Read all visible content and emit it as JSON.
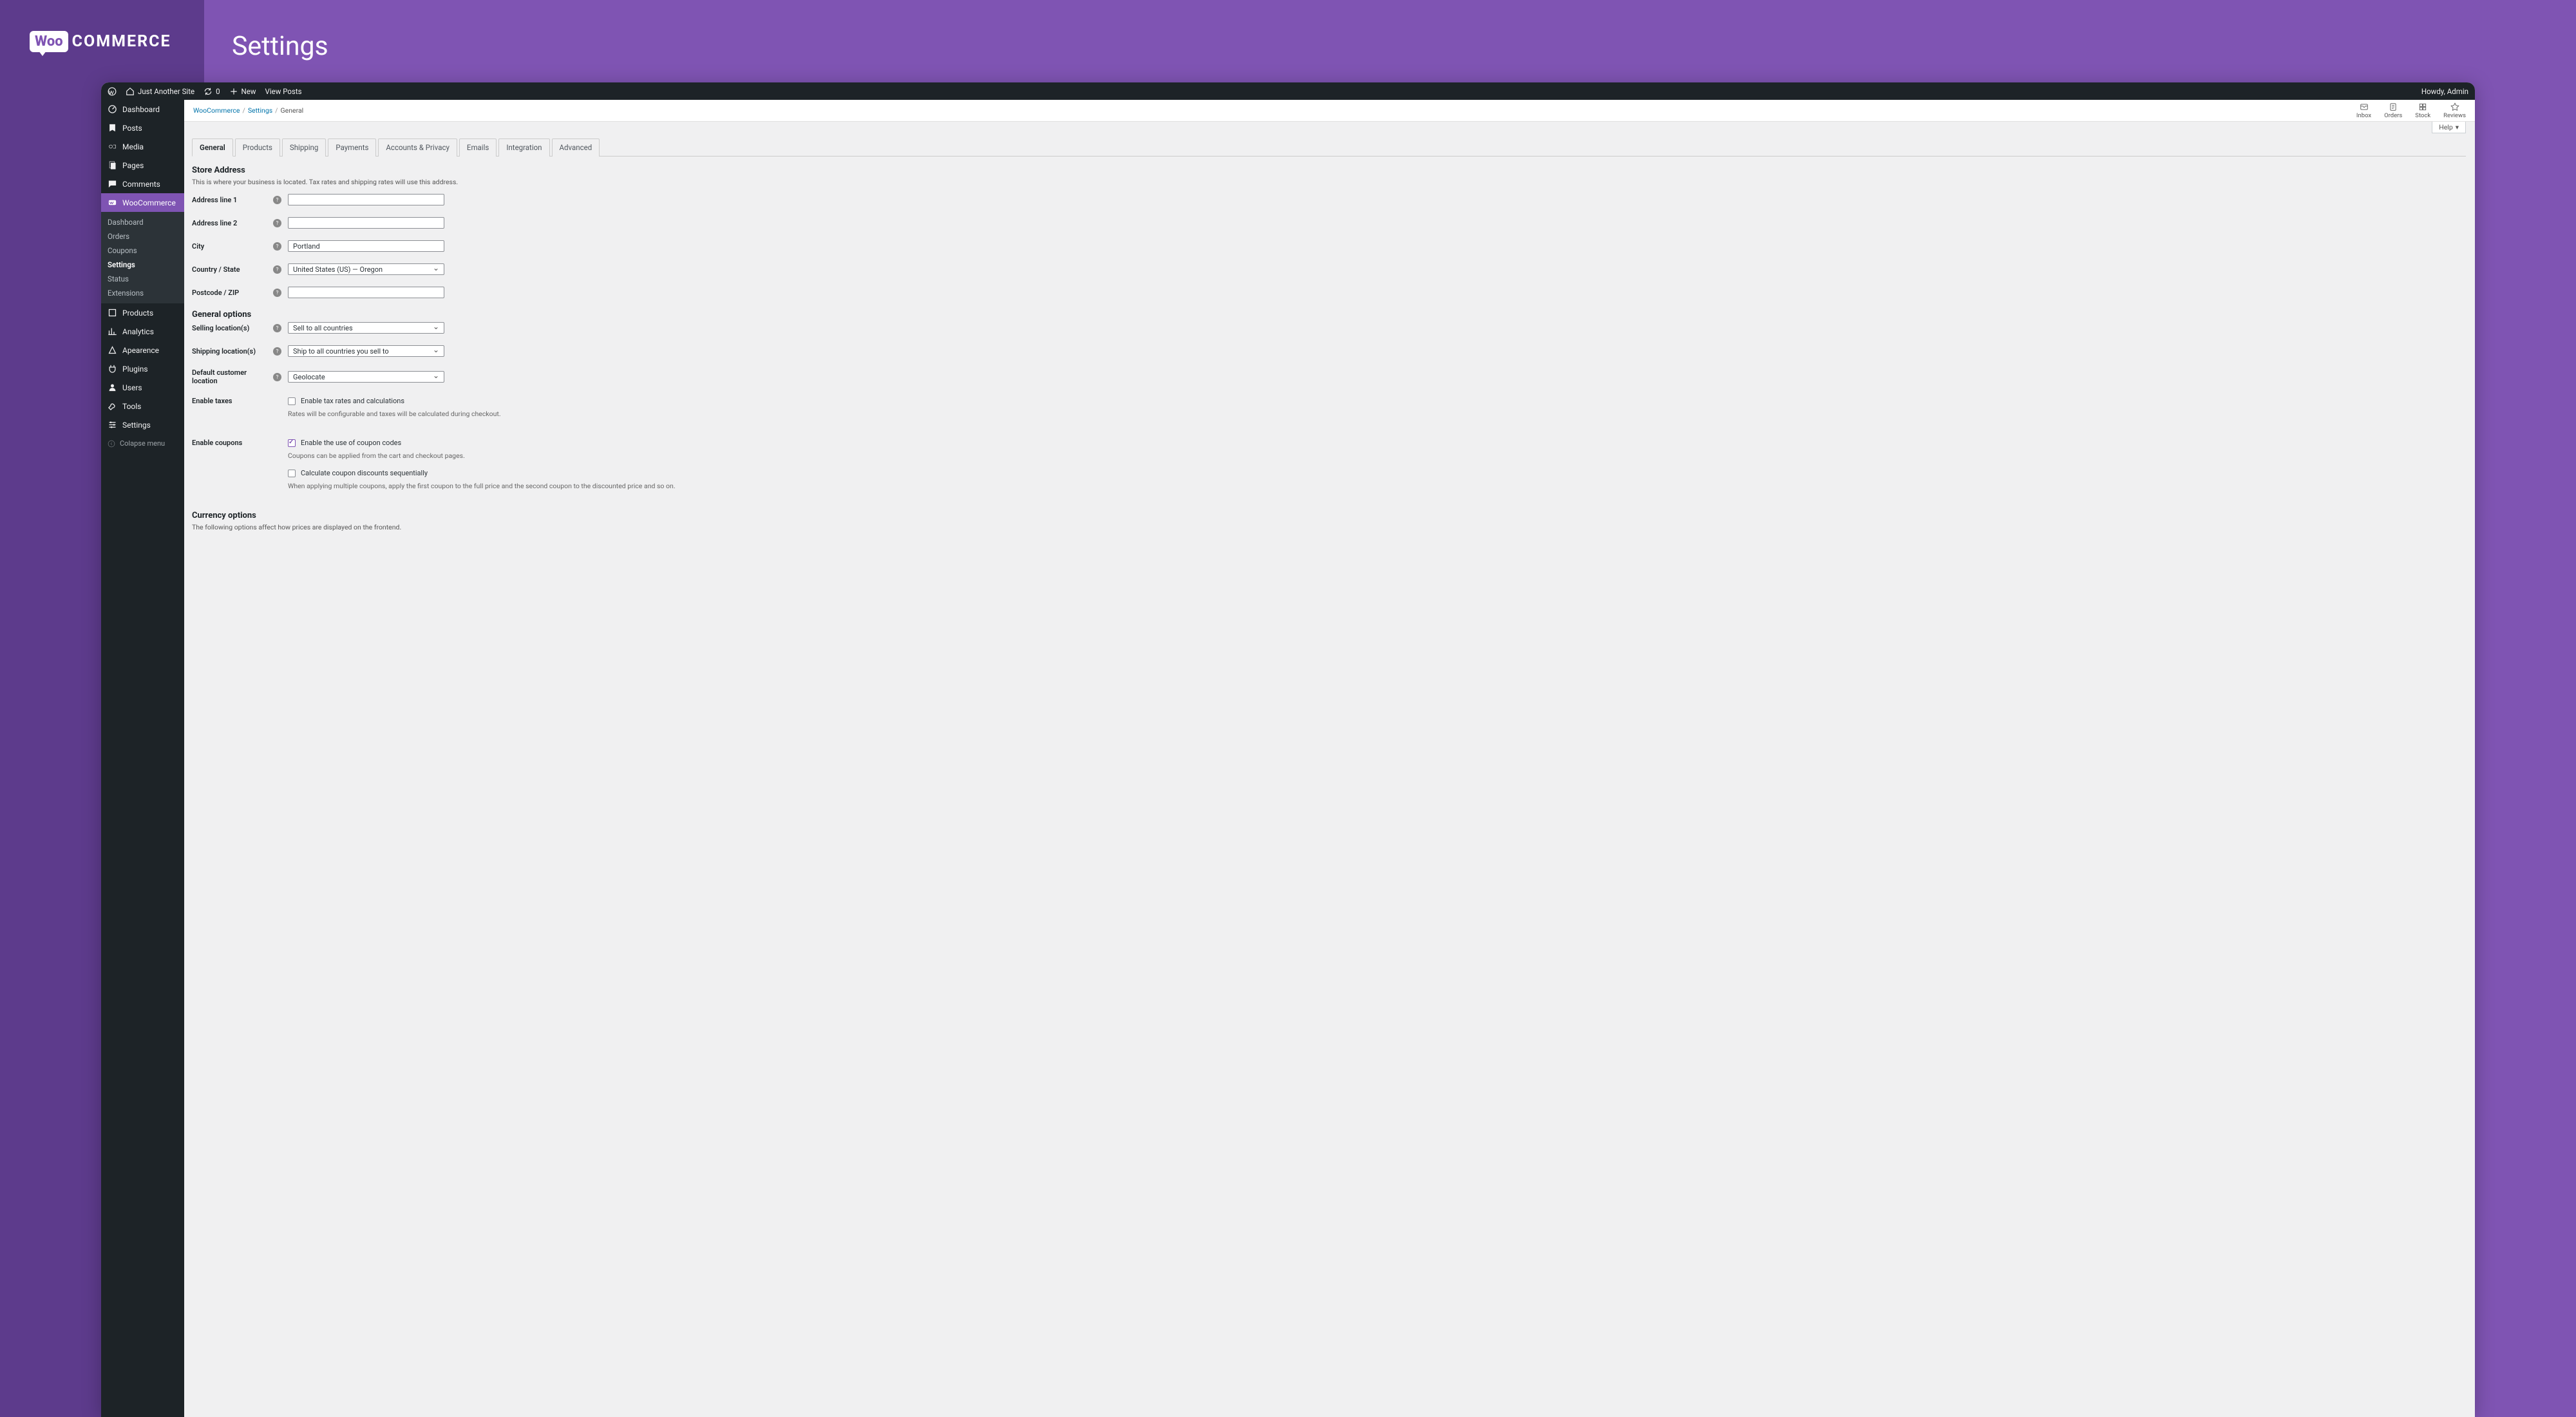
{
  "header": {
    "title": "Settings",
    "logo_mark": "Woo",
    "logo_text": "COMMERCE"
  },
  "adminbar": {
    "site_name": "Just Another Site",
    "update_count": "0",
    "new_label": "New",
    "view_posts": "View Posts",
    "greeting": "Howdy, Admin"
  },
  "sidebar": {
    "items": [
      {
        "label": "Dashboard"
      },
      {
        "label": "Posts"
      },
      {
        "label": "Media"
      },
      {
        "label": "Pages"
      },
      {
        "label": "Comments"
      },
      {
        "label": "WooCommerce",
        "active": true
      },
      {
        "label": "Products"
      },
      {
        "label": "Analytics"
      },
      {
        "label": "Apearence"
      },
      {
        "label": "Plugins"
      },
      {
        "label": "Users"
      },
      {
        "label": "Tools"
      },
      {
        "label": "Settings"
      }
    ],
    "submenu": [
      {
        "label": "Dashboard"
      },
      {
        "label": "Orders"
      },
      {
        "label": "Coupons"
      },
      {
        "label": "Settings",
        "current": true
      },
      {
        "label": "Status"
      },
      {
        "label": "Extensions"
      }
    ],
    "collapse": "Colapse menu"
  },
  "breadcrumb": {
    "crumb0": "WooCommerce",
    "crumb1": "Settings",
    "crumb2": "General"
  },
  "activity": {
    "inbox": "Inbox",
    "orders": "Orders",
    "stock": "Stock",
    "reviews": "Reviews"
  },
  "help_tab": "Help",
  "tabs": [
    "General",
    "Products",
    "Shipping",
    "Payments",
    "Accounts & Privacy",
    "Emails",
    "Integration",
    "Advanced"
  ],
  "sections": {
    "store": {
      "heading": "Store Address",
      "desc": "This is where your business is located. Tax rates and shipping rates will use this address."
    },
    "general": {
      "heading": "General options"
    },
    "currency": {
      "heading": "Currency options",
      "desc": "The following options affect how prices are displayed on the frontend."
    }
  },
  "fields": {
    "addr1": {
      "label": "Address line 1",
      "value": ""
    },
    "addr2": {
      "label": "Address line 2",
      "value": ""
    },
    "city": {
      "label": "City",
      "value": "Portland"
    },
    "country": {
      "label": "Country / State",
      "value": "United States (US) — Oregon"
    },
    "zip": {
      "label": "Postcode / ZIP",
      "value": ""
    },
    "selling": {
      "label": "Selling location(s)",
      "value": "Sell to all countries"
    },
    "shipping": {
      "label": "Shipping location(s)",
      "value": "Ship to all countries you sell to"
    },
    "defloc": {
      "label": "Default customer location",
      "value": "Geolocate"
    },
    "taxes": {
      "label": "Enable taxes",
      "cb_label": "Enable tax rates and calculations",
      "help": "Rates will be configurable and taxes will be calculated during checkout."
    },
    "coupons": {
      "label": "Enable coupons",
      "cb_label": "Enable the use of coupon codes",
      "help": "Coupons can be applied from the cart and checkout pages.",
      "cb2_label": "Calculate coupon discounts sequentially",
      "help2": "When applying multiple coupons, apply the first coupon to the full price and the second coupon to the discounted price and so on."
    }
  }
}
